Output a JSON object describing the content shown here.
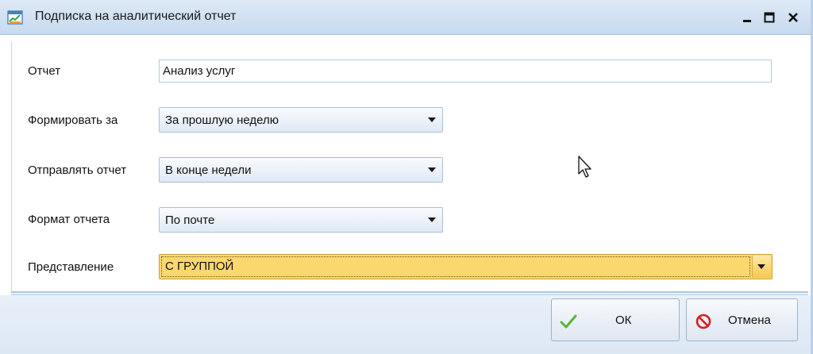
{
  "window": {
    "title": "Подписка на аналитический отчет"
  },
  "form": {
    "report_label": "Отчет",
    "report_value": "Анализ услуг",
    "period_label": "Формировать за",
    "period_value": "За прошлую неделю",
    "send_label": "Отправлять отчет",
    "send_value": "В конце недели",
    "format_label": "Формат отчета",
    "format_value": "По почте",
    "view_label": "Представление",
    "view_value": "С ГРУППОЙ"
  },
  "buttons": {
    "ok": "ОК",
    "cancel": "Отмена"
  },
  "colors": {
    "titlebar": "#c7daef",
    "highlight": "#fbd86e",
    "ok_icon": "#5ab535",
    "cancel_icon": "#d42020"
  },
  "icons": {
    "app": "chart-report-icon",
    "minimize": "minimize-icon",
    "maximize": "maximize-icon",
    "close": "close-icon",
    "ok": "checkmark-icon",
    "cancel": "no-entry-icon"
  }
}
